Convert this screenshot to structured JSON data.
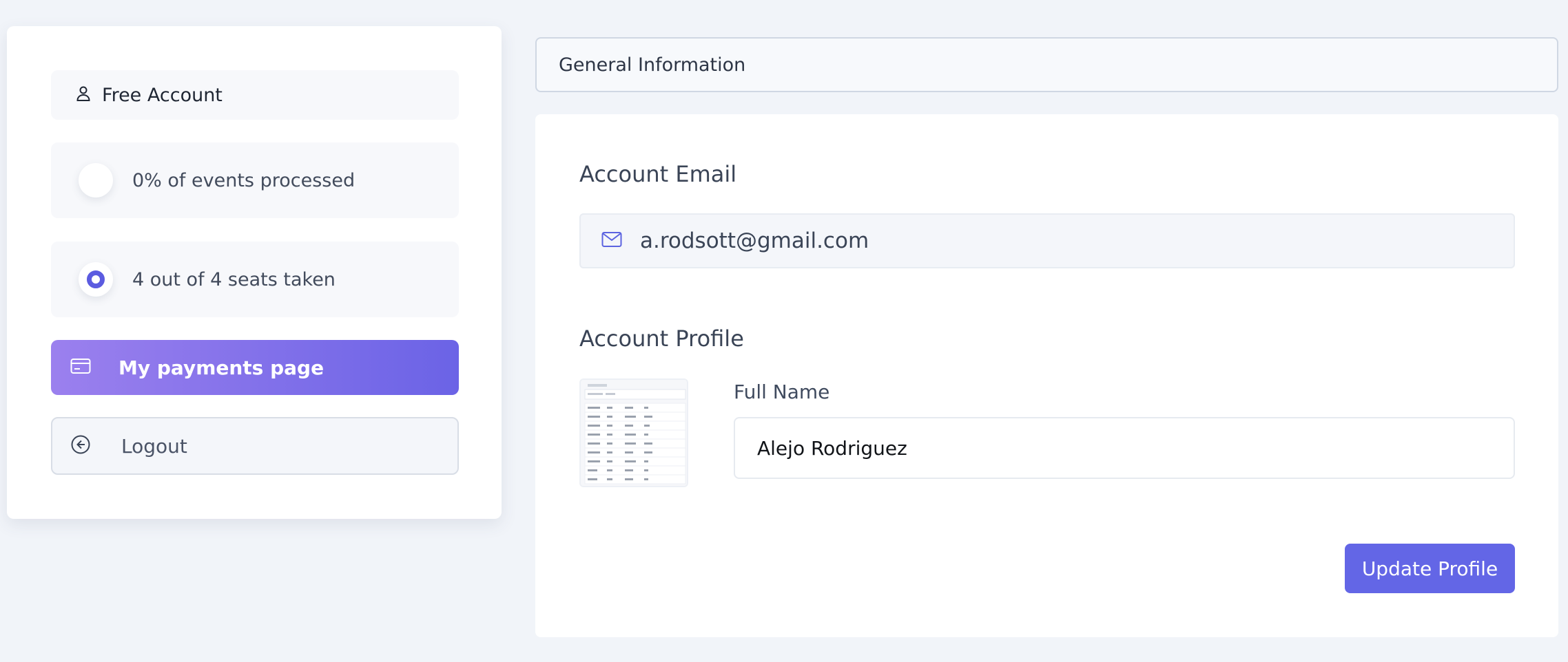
{
  "sidebar": {
    "plan_label": "Free Account",
    "events_stat": "0% of events processed",
    "seats_stat": "4 out of 4 seats taken",
    "payments_label": "My payments page",
    "logout_label": "Logout"
  },
  "tabs": {
    "general_information": "General Information"
  },
  "account_email": {
    "title": "Account Email",
    "value": "a.rodsott@gmail.com"
  },
  "account_profile": {
    "title": "Account Profile",
    "full_name_label": "Full Name",
    "full_name_value": "Alejo Rodriguez",
    "update_button": "Update Profile"
  },
  "colors": {
    "accent": "#6366e6",
    "gradient_start": "#9b80ee",
    "gradient_end": "#6b63e6",
    "page_background": "#f1f4f9"
  },
  "icons": {
    "plan": "user-icon",
    "email": "envelope-icon",
    "payments": "credit-card-icon",
    "logout": "arrow-left-circle-icon"
  }
}
